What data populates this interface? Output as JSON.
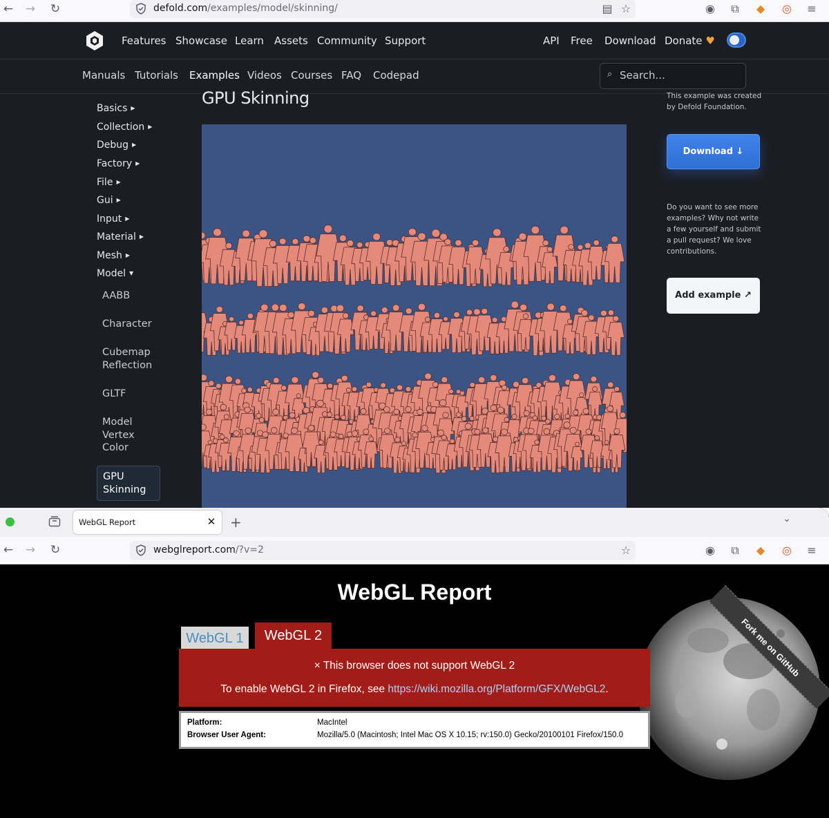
{
  "top_browser": {
    "url_domain": "defold.com",
    "url_path": "/examples/model/skinning/"
  },
  "site": {
    "nav_left": [
      "Features",
      "Showcase",
      "Learn",
      "Assets",
      "Community",
      "Support"
    ],
    "nav_right": [
      "API",
      "Free",
      "Download",
      "Donate"
    ],
    "donate_icon": "heart-icon",
    "sub_nav": [
      "Manuals",
      "Tutorials",
      "Examples",
      "Videos",
      "Courses",
      "FAQ",
      "Codepad"
    ],
    "sub_nav_active": "Examples",
    "search_placeholder": "Search..."
  },
  "sidebar": {
    "categories": [
      "Basics",
      "Collection",
      "Debug",
      "Factory",
      "File",
      "Gui",
      "Input",
      "Material",
      "Mesh",
      "Model"
    ],
    "expanded": "Model",
    "model_items": [
      "AABB",
      "Character",
      "Cubemap Reflection",
      "GLTF",
      "Model Vertex Color",
      "GPU Skinning"
    ],
    "active_item": "GPU Skinning"
  },
  "main": {
    "title": "GPU Skinning",
    "canvas_background": "#3b5483",
    "figure_color": "#e58a7a"
  },
  "right_panel": {
    "created_note": "This example was created by Defold Foundation.",
    "download_label": "Download ↓",
    "contribute_note": "Do you want to see more examples? Why not write a few yourself and submit a pull request? We love contributions.",
    "add_example_label": "Add example ↗"
  },
  "bottom_browser": {
    "tab_title": "WebGL Report",
    "url_domain": "webglreport.com",
    "url_path": "/?v=2"
  },
  "report": {
    "title": "WebGL Report",
    "tab_webgl1": "WebGL 1",
    "tab_webgl2": "WebGL 2",
    "error_line1": "× This browser does not support WebGL 2",
    "error_line2_prefix": "To enable WebGL 2 in Firefox, see ",
    "error_link": "https://wiki.mozilla.org/Platform/GFX/WebGL2",
    "error_line2_suffix": ".",
    "platform_label": "Platform:",
    "platform_value": "MacIntel",
    "user_agent_label": "Browser User Agent:",
    "user_agent_value": "Mozilla/5.0 (Macintosh; Intel Mac OS X 10.15; rv:150.0) Gecko/20100101 Firefox/150.0",
    "ribbon_text": "Fork me on GitHub",
    "error_color": "#a21d17"
  }
}
